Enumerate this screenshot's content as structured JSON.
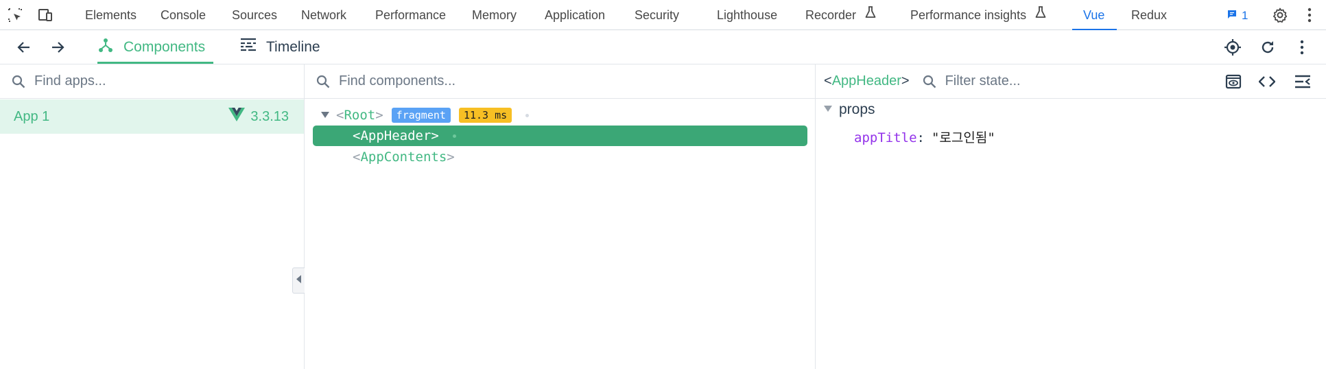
{
  "devtools": {
    "tabs": [
      {
        "label": "Elements",
        "active": false
      },
      {
        "label": "Console",
        "active": false
      },
      {
        "label": "Sources",
        "active": false
      },
      {
        "label": "Network",
        "active": false
      },
      {
        "label": "Performance",
        "active": false
      },
      {
        "label": "Memory",
        "active": false
      },
      {
        "label": "Application",
        "active": false
      },
      {
        "label": "Security",
        "active": false
      },
      {
        "label": "Lighthouse",
        "active": false
      },
      {
        "label": "Recorder",
        "active": false,
        "experimental": true
      },
      {
        "label": "Performance insights",
        "active": false,
        "experimental": true
      },
      {
        "label": "Vue",
        "active": true
      },
      {
        "label": "Redux",
        "active": false
      }
    ],
    "issues_count": "1",
    "accent_color": "#1a73e8"
  },
  "vue_toolbar": {
    "tabs": [
      {
        "label": "Components",
        "active": true,
        "icon": "components-icon"
      },
      {
        "label": "Timeline",
        "active": false,
        "icon": "timeline-icon"
      }
    ],
    "accent_color": "#42b883"
  },
  "apps_pane": {
    "search_placeholder": "Find apps...",
    "apps": [
      {
        "name": "App 1",
        "version": "3.3.13",
        "selected": true
      }
    ]
  },
  "tree_pane": {
    "search_placeholder": "Find components...",
    "nodes": [
      {
        "name": "Root",
        "badges": [
          "fragment",
          "11.3 ms"
        ],
        "expanded": true,
        "selected": false
      },
      {
        "name": "AppHeader",
        "badges": [],
        "selected": true
      },
      {
        "name": "AppContents",
        "badges": [],
        "selected": false
      }
    ]
  },
  "state_pane": {
    "selected_component": "AppHeader",
    "filter_placeholder": "Filter state...",
    "section": "props",
    "props": [
      {
        "key": "appTitle",
        "value": "\"로그인됨\""
      }
    ]
  }
}
